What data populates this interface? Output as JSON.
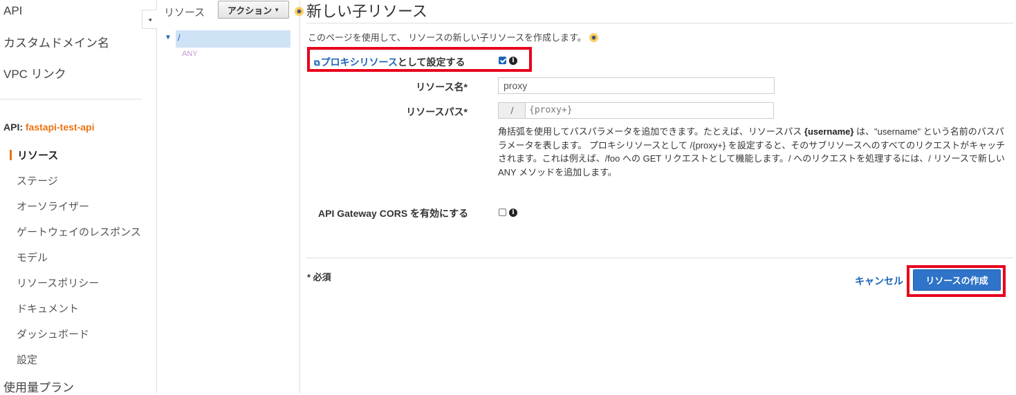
{
  "nav": {
    "top_items": [
      "API",
      "カスタムドメイン名",
      "VPC リンク"
    ],
    "api_prefix": "API:",
    "api_name": "fastapi-test-api",
    "items": [
      "リソース",
      "ステージ",
      "オーソライザー",
      "ゲートウェイのレスポンス",
      "モデル",
      "リソースポリシー",
      "ドキュメント",
      "ダッシュボード",
      "設定"
    ],
    "active_item": "リソース",
    "bottom_item": "使用量プラン",
    "toggle_icon": "◂"
  },
  "tree": {
    "title": "リソース",
    "actions_label": "アクション",
    "root": "/",
    "method": "ANY"
  },
  "main": {
    "title": "新しい子リソース",
    "description": "このページを使用して、 リソースの新しい子リソースを作成します。",
    "proxy_link": "プロキシリソース",
    "proxy_suffix": "として設定する",
    "proxy_checked": true,
    "resource_name_label": "リソース名*",
    "resource_name_value": "proxy",
    "resource_path_label": "リソースパス*",
    "resource_path_prefix": "/",
    "resource_path_value": "{proxy+}",
    "help_1": "角括弧を使用してパスパラメータを追加できます。たとえば、リソースパス ",
    "help_username": "{username}",
    "help_2": " は、\"username\" という名前のパスパラメータを表します。 プロキシリソースとして /{proxy+} を設定すると、そのサブリソースへのすべてのリクエストがキャッチされます。これは例えば、/foo への GET リクエストとして機能します。/ へのリクエストを処理するには、/ リソースで新しい ANY メソッドを追加します。",
    "cors_label": "API Gateway CORS を有効にする",
    "cors_checked": false,
    "required_note": "* 必須",
    "cancel_label": "キャンセル",
    "create_label": "リソースの作成"
  },
  "colors": {
    "accent": "#ec7211",
    "link": "#1a64b8",
    "primary_button": "#2f74c8",
    "highlight_box": "#e8001c"
  }
}
